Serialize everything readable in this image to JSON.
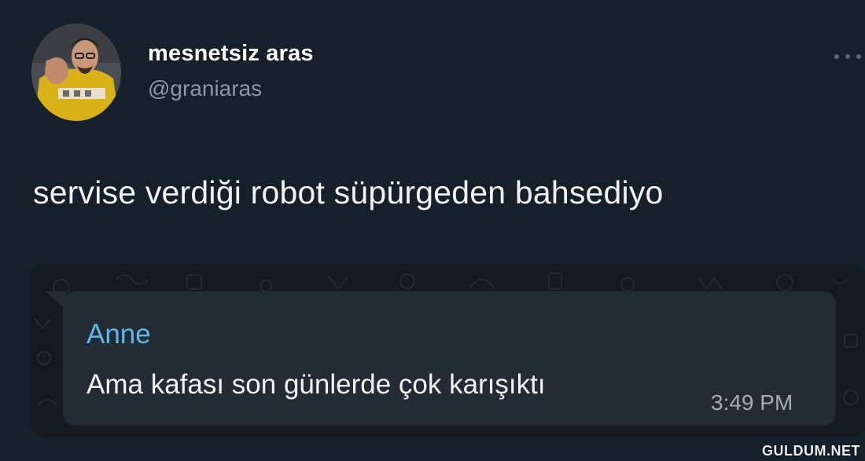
{
  "author": {
    "display_name": "mesnetsiz aras",
    "handle": "@graniaras",
    "avatar_icon": "profile-photo"
  },
  "tweet": {
    "text": "servise verdiği robot süpürgeden bahsediyo"
  },
  "embedded_chat": {
    "sender": "Anne",
    "message": "Ama kafası son günlerde çok karışıktı",
    "time": "3:49 PM"
  },
  "watermark": "GULDUM.NET",
  "colors": {
    "background": "#15202b",
    "sender_name": "#5fb6e8",
    "bubble": "#232b35"
  }
}
